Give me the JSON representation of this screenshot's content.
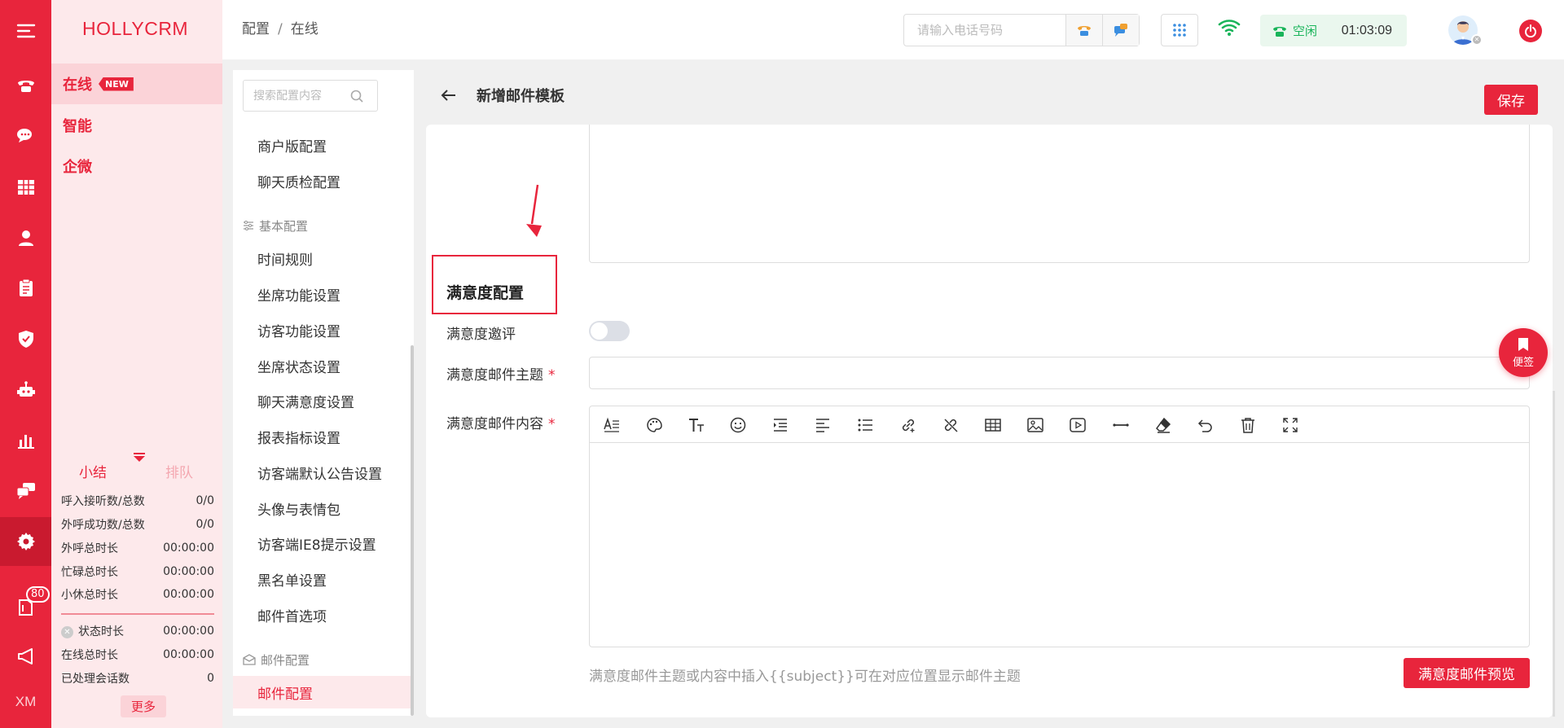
{
  "brand": "HOLLYCRM",
  "rail": {
    "badge": "80",
    "bottom_label": "XM",
    "icons": [
      "menu-icon",
      "phone-icon",
      "chat-icon",
      "grid-icon",
      "user-icon",
      "clipboard-icon",
      "shield-icon",
      "robot-icon",
      "bar-chart-icon",
      "message-icon",
      "gear-icon",
      "book-icon",
      "megaphone-icon"
    ]
  },
  "nav": {
    "items": [
      {
        "label": "在线",
        "tag": "NEW"
      },
      {
        "label": "智能"
      },
      {
        "label": "企微"
      }
    ],
    "tabs": [
      "小结",
      "排队"
    ],
    "stats": [
      {
        "label": "呼入接听数/总数",
        "value": "0/0"
      },
      {
        "label": "外呼成功数/总数",
        "value": "0/0"
      },
      {
        "label": "外呼总时长",
        "value": "00:00:00"
      },
      {
        "label": "忙碌总时长",
        "value": "00:00:00"
      },
      {
        "label": "小休总时长",
        "value": "00:00:00"
      },
      {
        "label": "状态时长",
        "value": "00:00:00"
      },
      {
        "label": "在线总时长",
        "value": "00:00:00"
      },
      {
        "label": "已处理会话数",
        "value": "0"
      }
    ],
    "more": "更多"
  },
  "header": {
    "breadcrumb": [
      "配置",
      "在线"
    ],
    "breadcrumb_sep": "/",
    "phone_placeholder": "请输入电话号码",
    "status_label": "空闲",
    "status_time": "01:03:09",
    "status_color": "#19b45a"
  },
  "config": {
    "search_placeholder": "搜索配置内容",
    "items_top": [
      "商户版配置",
      "聊天质检配置"
    ],
    "group_basic": "基本配置",
    "items_basic": [
      "时间规则",
      "坐席功能设置",
      "访客功能设置",
      "坐席状态设置",
      "聊天满意度设置",
      "报表指标设置",
      "访客端默认公告设置",
      "头像与表情包",
      "访客端IE8提示设置",
      "黑名单设置",
      "邮件首选项"
    ],
    "group_mail": "邮件配置",
    "active_item": "邮件配置"
  },
  "main": {
    "title": "新增邮件模板",
    "save": "保存",
    "section_title": "满意度配置",
    "invite_label": "满意度邀评",
    "subject_label": "满意度邮件主题",
    "content_label": "满意度邮件内容",
    "required_mark": "*",
    "hint": "满意度邮件主题或内容中插入{{subject}}可在对应位置显示邮件主题",
    "preview": "满意度邮件预览",
    "invite_enabled": false
  },
  "toolbar_icons": [
    "heading-icon",
    "palette-icon",
    "font-size-icon",
    "emoji-icon",
    "indent-icon",
    "align-left-icon",
    "bullet-list-icon",
    "link-icon",
    "unlink-icon",
    "table-icon",
    "image-icon",
    "video-icon",
    "horizontal-rule-icon",
    "eraser-icon",
    "undo-icon",
    "trash-icon",
    "fullscreen-icon"
  ],
  "sticky": {
    "label": "便签"
  },
  "accent_color": "#e8253c"
}
